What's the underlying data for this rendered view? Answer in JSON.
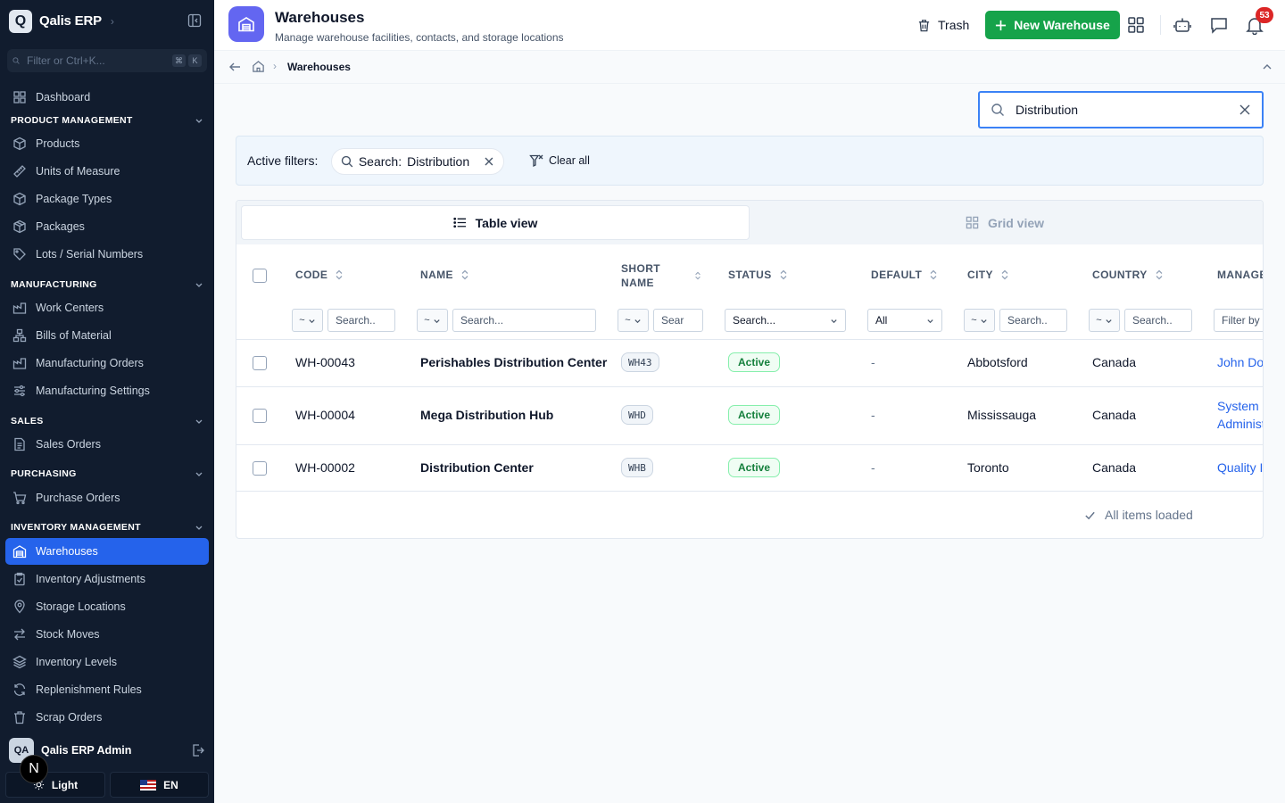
{
  "app": {
    "logo_letter": "Q",
    "name": "Qalis ERP"
  },
  "sidebar": {
    "search_placeholder": "Filter or Ctrl+K...",
    "kbd": [
      "⌘",
      "K"
    ],
    "dashboard": "Dashboard",
    "sections": {
      "product": "PRODUCT MANAGEMENT",
      "manufacturing": "MANUFACTURING",
      "sales": "SALES",
      "purchasing": "PURCHASING",
      "inventory": "INVENTORY MANAGEMENT"
    },
    "items": {
      "products": "Products",
      "uom": "Units of Measure",
      "package_types": "Package Types",
      "packages": "Packages",
      "lots": "Lots / Serial Numbers",
      "work_centers": "Work Centers",
      "bom": "Bills of Material",
      "mfg_orders": "Manufacturing Orders",
      "mfg_settings": "Manufacturing Settings",
      "sales_orders": "Sales Orders",
      "purchase_orders": "Purchase Orders",
      "warehouses": "Warehouses",
      "inv_adjust": "Inventory Adjustments",
      "storage": "Storage Locations",
      "stock_moves": "Stock Moves",
      "inv_levels": "Inventory Levels",
      "replenish": "Replenishment Rules",
      "scrap": "Scrap Orders"
    },
    "user": {
      "initials": "QA",
      "name": "Qalis ERP Admin"
    },
    "n_badge": "N",
    "theme": "Light",
    "language": "EN"
  },
  "header": {
    "title": "Warehouses",
    "subtitle": "Manage warehouse facilities, contacts, and storage locations",
    "trash": "Trash",
    "new_button": "New Warehouse",
    "notifications_count": "53"
  },
  "breadcrumb": {
    "separator": "›",
    "current": "Warehouses"
  },
  "search": {
    "value": "Distribution"
  },
  "filters": {
    "label": "Active filters:",
    "chip_key": "Search:",
    "chip_value": "Distribution",
    "clear_all": "Clear all"
  },
  "views": {
    "table": "Table view",
    "grid": "Grid view"
  },
  "table": {
    "columns": {
      "code": "CODE",
      "name": "NAME",
      "short_line1": "SHORT",
      "short_line2": "NAME",
      "status": "STATUS",
      "default": "DEFAULT",
      "city": "CITY",
      "country": "COUNTRY",
      "manager": "MANAGE"
    },
    "filter_row": {
      "op": "~",
      "search_short": "Search..",
      "search_long": "Search...",
      "short_search": "Sear",
      "status_search": "Search...",
      "default_value": "All",
      "manager_placeholder": "Filter by"
    },
    "rows": [
      {
        "code": "WH-00043",
        "name": "Perishables Distribution Center",
        "short": "WH43",
        "status": "Active",
        "default": "-",
        "city": "Abbotsford",
        "country": "Canada",
        "manager": "John Do"
      },
      {
        "code": "WH-00004",
        "name": "Mega Distribution Hub",
        "short": "WHD",
        "status": "Active",
        "default": "-",
        "city": "Mississauga",
        "country": "Canada",
        "manager_line1": "System",
        "manager_line2": "Administ"
      },
      {
        "code": "WH-00002",
        "name": "Distribution Center",
        "short": "WHB",
        "status": "Active",
        "default": "-",
        "city": "Toronto",
        "country": "Canada",
        "manager": "Quality I"
      }
    ],
    "footer": "All items loaded"
  }
}
